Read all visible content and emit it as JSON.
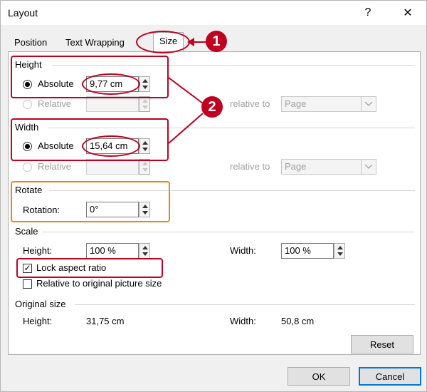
{
  "window": {
    "title": "Layout",
    "help_glyph": "?",
    "close_glyph": "✕"
  },
  "tabs": [
    {
      "label": "Position"
    },
    {
      "label": "Text Wrapping"
    },
    {
      "label": "Size",
      "active": true
    }
  ],
  "height": {
    "group_label": "Height",
    "absolute_label": "Absolute",
    "absolute_value": "9,77 cm",
    "relative_label": "Relative",
    "relative_value": "",
    "relative_to_label": "relative to",
    "relative_to_value": "Page"
  },
  "width": {
    "group_label": "Width",
    "absolute_label": "Absolute",
    "absolute_value": "15,64 cm",
    "relative_label": "Relative",
    "relative_value": "",
    "relative_to_label": "relative to",
    "relative_to_value": "Page"
  },
  "rotate": {
    "group_label": "Rotate",
    "rotation_label": "Rotation:",
    "rotation_value": "0°"
  },
  "scale": {
    "group_label": "Scale",
    "height_label": "Height:",
    "height_value": "100 %",
    "width_label": "Width:",
    "width_value": "100 %",
    "lock_aspect_label": "Lock aspect ratio",
    "lock_aspect_checked": true,
    "relative_original_label": "Relative to original picture size",
    "relative_original_checked": false
  },
  "original_size": {
    "group_label": "Original size",
    "height_label": "Height:",
    "height_value": "31,75 cm",
    "width_label": "Width:",
    "width_value": "50,8 cm"
  },
  "buttons": {
    "reset": "Reset",
    "ok": "OK",
    "cancel": "Cancel"
  },
  "annotations": {
    "badge1": "1",
    "badge2": "2",
    "annotation_color": "#c00020",
    "rotate_highlight_color": "#e08a1e"
  },
  "icons": {
    "check": "✓",
    "dropdown": "chevron-down-icon"
  }
}
